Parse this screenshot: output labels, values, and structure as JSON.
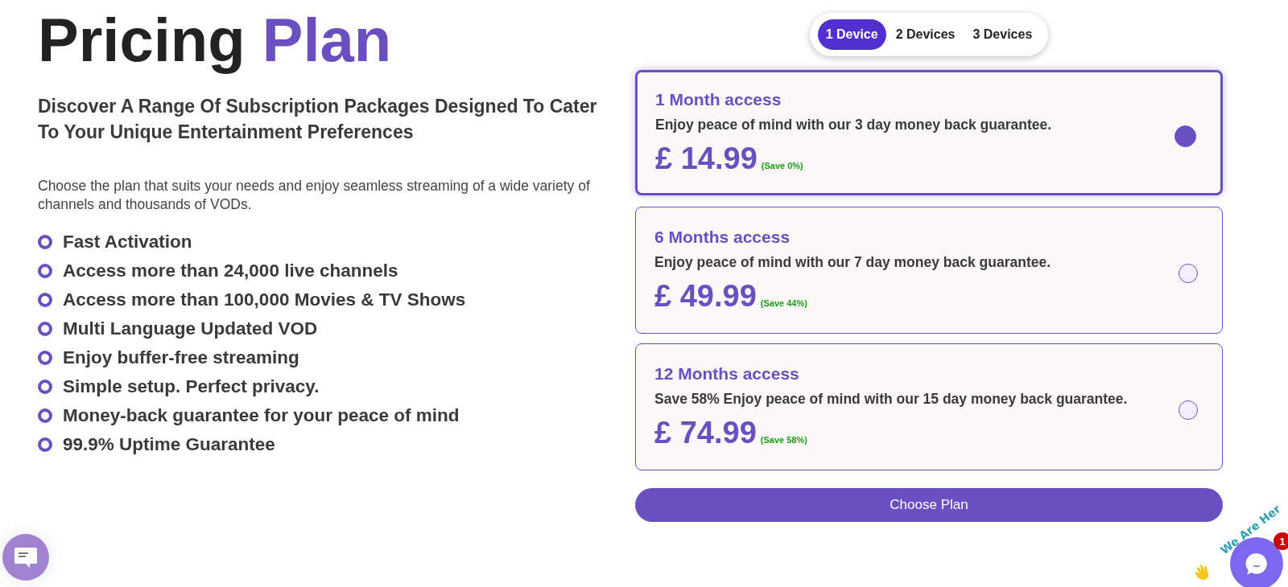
{
  "heading": {
    "text": "Pricing",
    "accent": "Plan"
  },
  "subtitle": "Discover A Range Of Subscription Packages Designed To Cater To Your Unique Entertainment Preferences",
  "intro": "Choose the plan that suits your needs and enjoy seamless streaming of a wide variety of channels and thousands of VODs.",
  "features": [
    "Fast Activation",
    "Access more than 24,000 live channels",
    "Access more than 100,000 Movies & TV Shows",
    "Multi Language Updated VOD",
    "Enjoy buffer-free streaming",
    "Simple setup. Perfect privacy.",
    "Money-back guarantee for your peace of mind",
    "99.9% Uptime Guarantee"
  ],
  "device_tabs": [
    {
      "label": "1 Device",
      "selected": true
    },
    {
      "label": "2 Devices",
      "selected": false
    },
    {
      "label": "3 Devices",
      "selected": false
    }
  ],
  "plans": [
    {
      "title": "1 Month access",
      "description": "Enjoy peace of mind with our 3 day money back guarantee.",
      "price": "£ 14.99",
      "saving": "(Save 0%)",
      "selected": true
    },
    {
      "title": "6 Months access",
      "description": "Enjoy peace of mind with our 7 day money back guarantee.",
      "price": "£ 49.99",
      "saving": "(Save 44%)",
      "selected": false
    },
    {
      "title": "12 Months access",
      "description": "Save 58% Enjoy peace of mind with our 15 day money back guarantee.",
      "price": "£ 74.99",
      "saving": "(Save 58%)",
      "selected": false
    }
  ],
  "choose_button": "Choose Plan",
  "chat_widget": {
    "tagline": "We Are Her",
    "badge": "1"
  }
}
